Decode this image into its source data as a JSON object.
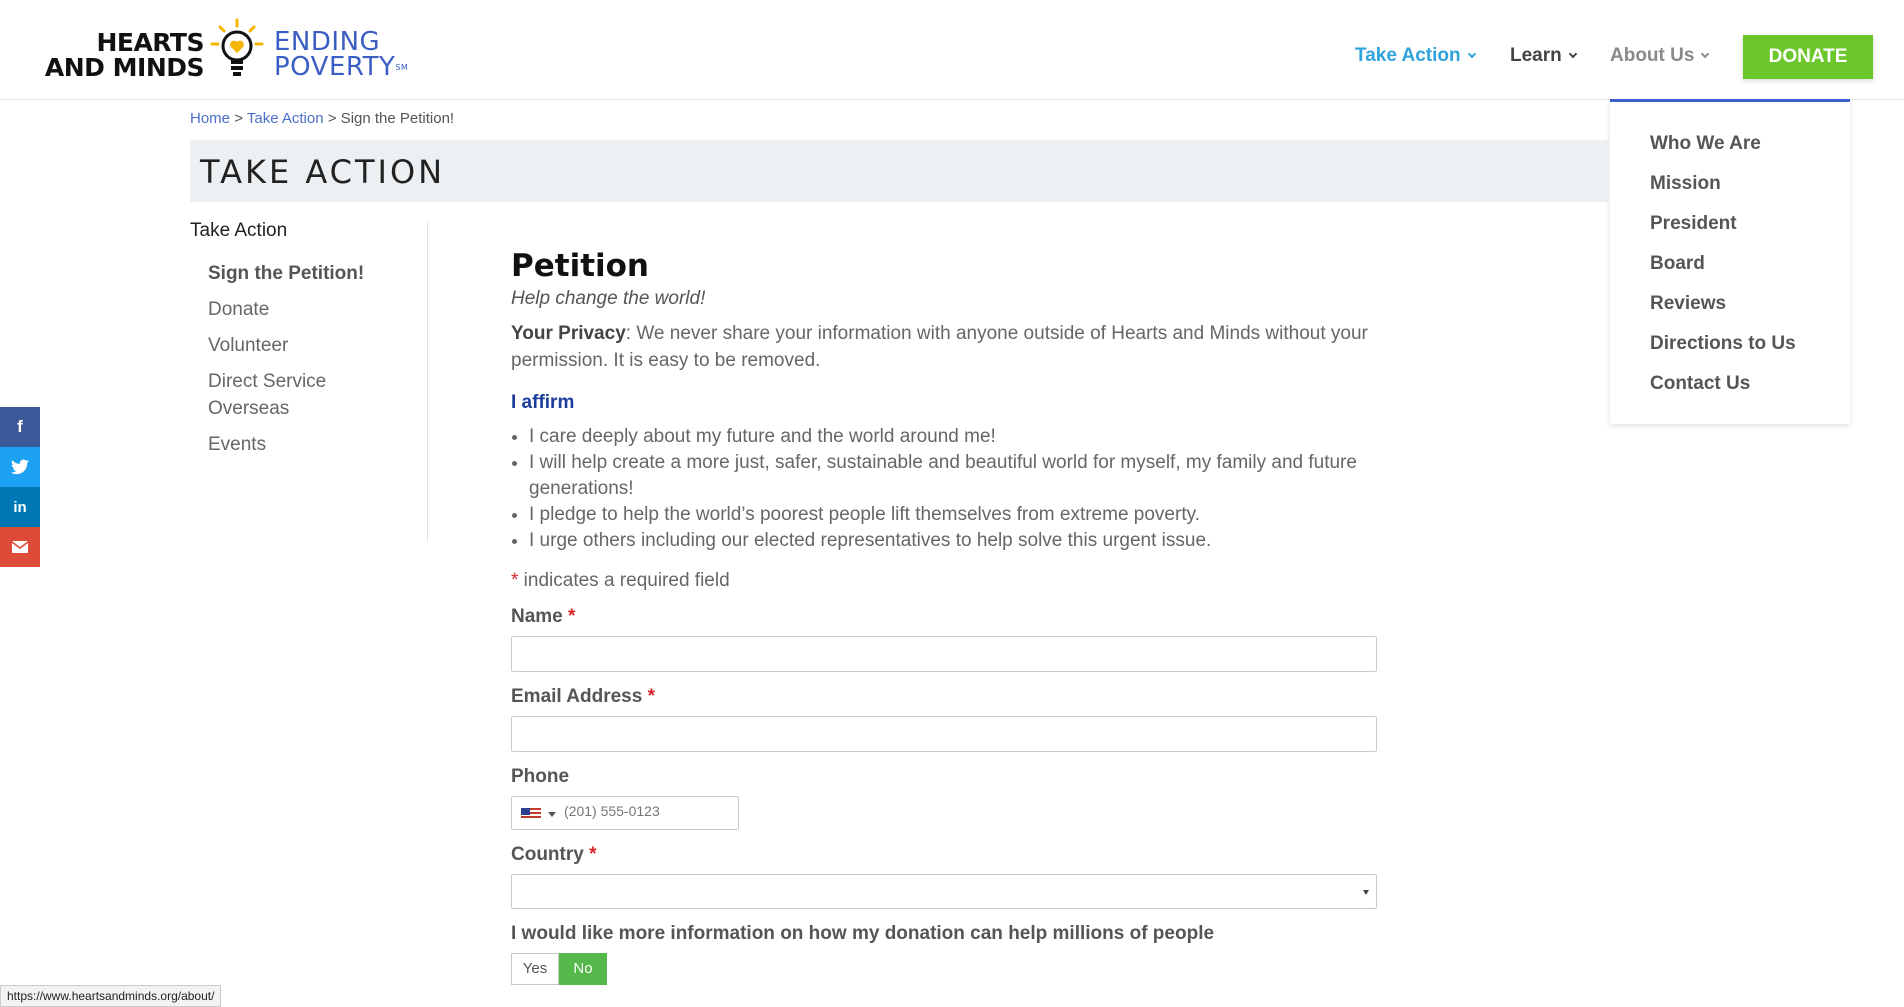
{
  "logo": {
    "left_line1": "HEARTS",
    "left_line2": "AND MINDS",
    "right_line1": "ENDING",
    "right_line2": "POVERTY",
    "mark": "SM"
  },
  "nav": {
    "take_action": "Take Action",
    "learn": "Learn",
    "about_us": "About Us",
    "donate": "DONATE"
  },
  "dropdown": {
    "items": [
      "Who We Are",
      "Mission",
      "President",
      "Board",
      "Reviews",
      "Directions to Us",
      "Contact Us"
    ]
  },
  "breadcrumb": {
    "home": "Home",
    "sep": ">",
    "take_action": "Take Action",
    "current": "Sign the Petition!"
  },
  "page_title": "TAKE ACTION",
  "sidebar": {
    "title": "Take Action",
    "items": [
      "Sign the Petition!",
      "Donate",
      "Volunteer",
      "Direct Service Overseas",
      "Events"
    ]
  },
  "social": [
    {
      "icon": "facebook-icon",
      "glyph": "f",
      "color": "#3b5998"
    },
    {
      "icon": "twitter-icon",
      "glyph": "🐦",
      "color": "#1da1f2"
    },
    {
      "icon": "linkedin-icon",
      "glyph": "in",
      "color": "#0077b5"
    },
    {
      "icon": "email-icon",
      "glyph": "✉",
      "color": "#dd4b39"
    }
  ],
  "content": {
    "heading": "Petition",
    "subheading": "Help change the world!",
    "privacy_label": "Your Privacy",
    "privacy_text": ": We never share your information with anyone outside of Hearts and Minds without your permission. It is easy to be removed.",
    "affirm_heading": "I affirm",
    "affirm_items": [
      "I care deeply about my future and the world around me!",
      "I will help create a more just, safer, sustainable and beautiful world for myself, my family and future generations!",
      "I pledge to help the world’s poorest people lift themselves from extreme poverty.",
      "I urge others including our elected representatives to help solve this urgent issue."
    ],
    "required_asterisk": "*",
    "required_note": " indicates a required field"
  },
  "form": {
    "name_label": "Name",
    "email_label": "Email Address",
    "phone_label": "Phone",
    "phone_placeholder": "(201) 555-0123",
    "country_label": "Country",
    "country_value": "",
    "info_label": "I would like more information on how my donation can help millions of people",
    "yes": "Yes",
    "no": "No",
    "selected": "No"
  },
  "status_url": "https://www.heartsandminds.org/about/"
}
